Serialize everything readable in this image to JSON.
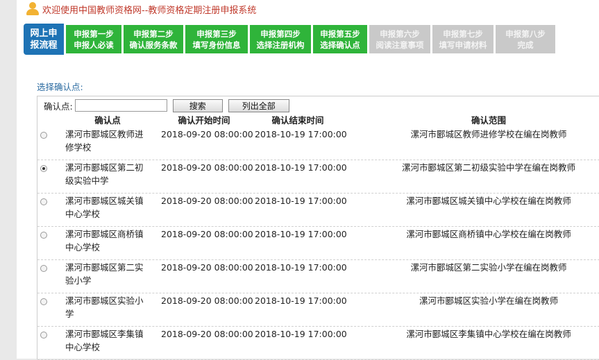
{
  "header": {
    "title": "欢迎使用中国教师资格网--教师资格定期注册申报系统"
  },
  "steps": {
    "first": {
      "line1": "网上申",
      "line2": "报流程"
    },
    "items": [
      {
        "line1": "申报第一步",
        "line2": "申报人必读",
        "state": "on"
      },
      {
        "line1": "申报第二步",
        "line2": "确认服务条款",
        "state": "on"
      },
      {
        "line1": "申报第三步",
        "line2": "填写身份信息",
        "state": "on"
      },
      {
        "line1": "申报第四步",
        "line2": "选择注册机构",
        "state": "on"
      },
      {
        "line1": "申报第五步",
        "line2": "选择确认点",
        "state": "on"
      },
      {
        "line1": "申报第六步",
        "line2": "阅读注意事项",
        "state": "off"
      },
      {
        "line1": "申报第七步",
        "line2": "填写申请材料",
        "state": "off"
      },
      {
        "line1": "申报第八步",
        "line2": "完成",
        "state": "off"
      }
    ]
  },
  "section_title": "选择确认点:",
  "search": {
    "label": "确认点:",
    "value": "",
    "search_button": "搜索",
    "list_all_button": "列出全部"
  },
  "table": {
    "headers": {
      "name": "确认点",
      "start": "确认开始时间",
      "end": "确认结束时间",
      "range": "确认范围"
    },
    "rows": [
      {
        "name": "漯河市郾城区教师进修学校",
        "start": "2018-09-20 08:00:00",
        "end": "2018-10-19 17:00:00",
        "range": "漯河市郾城区教师进修学校在编在岗教师",
        "checked": false
      },
      {
        "name": "漯河市郾城区第二初级实验中学",
        "start": "2018-09-20 08:00:00",
        "end": "2018-10-19 17:00:00",
        "range": "漯河市郾城区第二初级实验中学在编在岗教师",
        "checked": true
      },
      {
        "name": "漯河市郾城区城关镇中心学校",
        "start": "2018-09-20 08:00:00",
        "end": "2018-10-19 17:00:00",
        "range": "漯河市郾城区城关镇中心学校在编在岗教师",
        "checked": false
      },
      {
        "name": "漯河市郾城区商桥镇中心学校",
        "start": "2018-09-20 08:00:00",
        "end": "2018-10-19 17:00:00",
        "range": "漯河市郾城区商桥镇中心学校在编在岗教师",
        "checked": false
      },
      {
        "name": "漯河市郾城区第二实验小学",
        "start": "2018-09-20 08:00:00",
        "end": "2018-10-19 17:00:00",
        "range": "漯河市郾城区第二实验小学在编在岗教师",
        "checked": false
      },
      {
        "name": "漯河市郾城区实验小学",
        "start": "2018-09-20 08:00:00",
        "end": "2018-10-19 17:00:00",
        "range": "漯河市郾城区实验小学在编在岗教师",
        "checked": false
      },
      {
        "name": "漯河市郾城区李集镇中心学校",
        "start": "2018-09-20 08:00:00",
        "end": "2018-10-19 17:00:00",
        "range": "漯河市郾城区李集镇中心学校在编在岗教师",
        "checked": false
      }
    ]
  },
  "icons": {
    "header": "user-icon"
  }
}
